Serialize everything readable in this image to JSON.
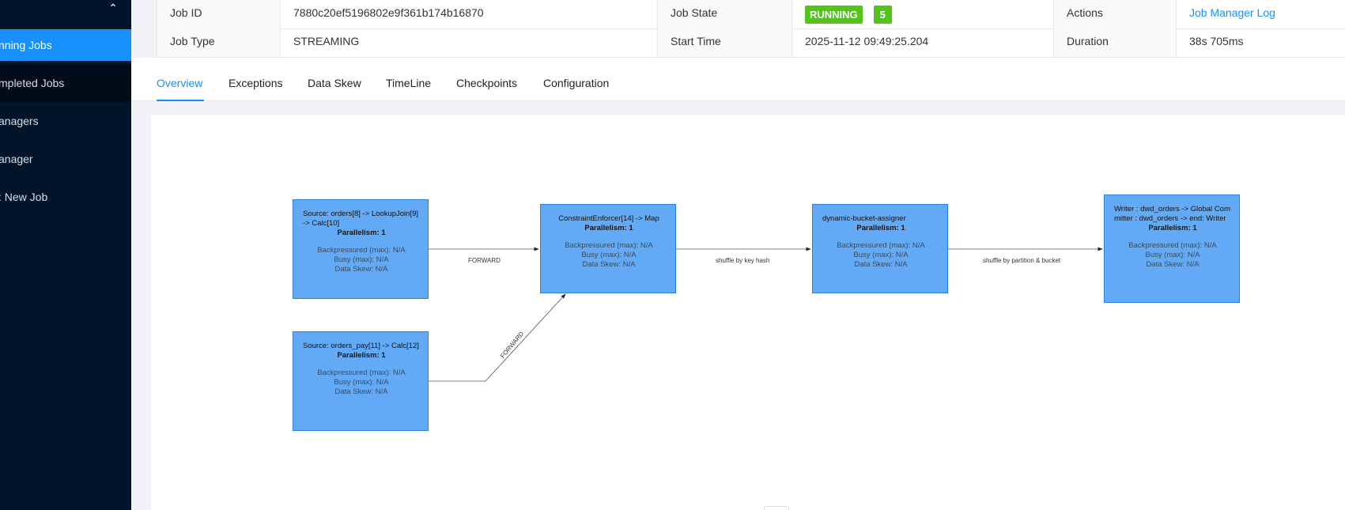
{
  "sidebar": {
    "items": [
      {
        "label": "nning Jobs"
      },
      {
        "label": "mpleted Jobs"
      },
      {
        "label": "anagers"
      },
      {
        "label": "anager"
      },
      {
        "label": ": New Job"
      }
    ]
  },
  "job": {
    "id_label": "Job ID",
    "id_value": "7880c20ef5196802e9f361b174b16870",
    "state_label": "Job State",
    "state_value": "RUNNING",
    "state_count": "5",
    "actions_label": "Actions",
    "actions_link": "Job Manager Log",
    "type_label": "Job Type",
    "type_value": "STREAMING",
    "start_label": "Start Time",
    "start_value": "2025-11-12 09:49:25.204",
    "duration_label": "Duration",
    "duration_value": "38s 705ms"
  },
  "tabs": [
    {
      "label": "Overview"
    },
    {
      "label": "Exceptions"
    },
    {
      "label": "Data Skew"
    },
    {
      "label": "TimeLine"
    },
    {
      "label": "Checkpoints"
    },
    {
      "label": "Configuration"
    }
  ],
  "graph": {
    "nodes": [
      {
        "title": "Source: orders[8] -> LookupJoin[9] -> Calc[10]",
        "parallelism": "Parallelism: 1",
        "backpressured": "Backpressured (max): N/A",
        "busy": "Busy (max): N/A",
        "skew": "Data Skew: N/A"
      },
      {
        "title": "Source: orders_pay[11] -> Calc[12]",
        "parallelism": "Parallelism: 1",
        "backpressured": "Backpressured (max): N/A",
        "busy": "Busy (max): N/A",
        "skew": "Data Skew: N/A"
      },
      {
        "title": "ConstraintEnforcer[14] -> Map",
        "parallelism": "Parallelism: 1",
        "backpressured": "Backpressured (max): N/A",
        "busy": "Busy (max): N/A",
        "skew": "Data Skew: N/A"
      },
      {
        "title": "dynamic-bucket-assigner",
        "parallelism": "Parallelism: 1",
        "backpressured": "Backpressured (max): N/A",
        "busy": "Busy (max): N/A",
        "skew": "Data Skew: N/A"
      },
      {
        "title": "Writer : dwd_orders -> Global Committer : dwd_orders -> end: Writer",
        "parallelism": "Parallelism: 1",
        "backpressured": "Backpressured (max): N/A",
        "busy": "Busy (max): N/A",
        "skew": "Data Skew: N/A"
      }
    ],
    "edges": [
      {
        "label": "FORWARD"
      },
      {
        "label": "FORWARD"
      },
      {
        "label": "shuffle by key hash"
      },
      {
        "label": "shuffle by partition & bucket"
      }
    ]
  },
  "colors": {
    "sidebar_bg": "#001529",
    "accent": "#1890ff",
    "running": "#52c41a",
    "node_fill": "#63aaf6"
  }
}
